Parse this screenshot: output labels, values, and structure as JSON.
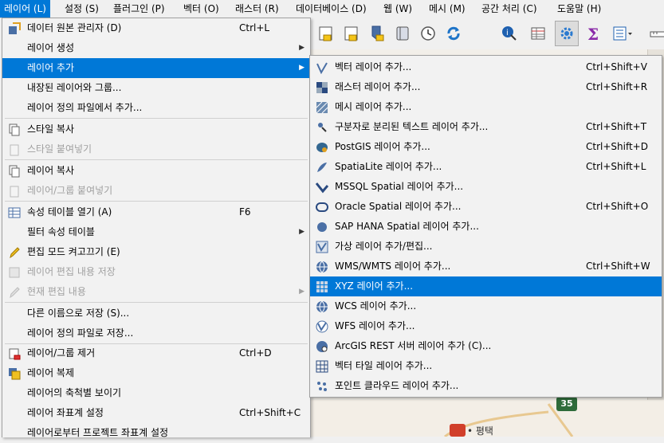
{
  "menubar": {
    "items": [
      {
        "label": "레이어 (L)",
        "active": true
      },
      {
        "label": "설정 (S)"
      },
      {
        "label": "플러그인 (P)"
      },
      {
        "label": "벡터 (O)"
      },
      {
        "label": "래스터 (R)"
      },
      {
        "label": "데이터베이스 (D)"
      },
      {
        "label": "웹 (W)"
      },
      {
        "label": "메시 (M)"
      },
      {
        "label": "공간 처리 (C)"
      },
      {
        "label": "도움말 (H)"
      }
    ]
  },
  "layer_menu": {
    "items": [
      {
        "label": "데이터 원본 관리자 (D)",
        "shortcut": "Ctrl+L",
        "icon": "data-source-manager-icon"
      },
      {
        "label": "레이어 생성",
        "submenu": true
      },
      {
        "label": "레이어 추가",
        "submenu": true,
        "highlighted": true
      },
      {
        "label": "내장된 레이어와 그룹..."
      },
      {
        "label": "레이어 정의 파일에서 추가..."
      },
      {
        "label": "스타일 복사",
        "icon": "copy-style-icon"
      },
      {
        "label": "스타일 붙여넣기",
        "icon": "paste-style-icon",
        "disabled": true
      },
      {
        "label": "레이어 복사",
        "icon": "copy-layer-icon"
      },
      {
        "label": "레이어/그룹 붙여넣기",
        "icon": "paste-layer-icon",
        "disabled": true
      },
      {
        "label": "속성 테이블 열기 (A)",
        "shortcut": "F6",
        "icon": "attribute-table-icon"
      },
      {
        "label": "필터 속성 테이블",
        "submenu": true
      },
      {
        "label": "편집 모드 켜고끄기 (E)",
        "icon": "toggle-editing-icon"
      },
      {
        "label": "레이어 편집 내용 저장",
        "icon": "save-edits-icon",
        "disabled": true
      },
      {
        "label": "현재 편집 내용",
        "icon": "current-edits-icon",
        "disabled": true,
        "submenu": true
      },
      {
        "label": "다른 이름으로 저장 (S)..."
      },
      {
        "label": "레이어 정의 파일로 저장..."
      },
      {
        "label": "레이어/그룹 제거",
        "shortcut": "Ctrl+D",
        "icon": "remove-layer-icon"
      },
      {
        "label": "레이어 복제",
        "icon": "duplicate-layer-icon"
      },
      {
        "label": "레이어의 축척별 보이기"
      },
      {
        "label": "레이어 좌표계 설정",
        "shortcut": "Ctrl+Shift+C"
      },
      {
        "label": "레이어로부터 프로젝트 좌표계 설정"
      }
    ]
  },
  "add_layer_menu": {
    "items": [
      {
        "label": "벡터 레이어 추가...",
        "shortcut": "Ctrl+Shift+V",
        "icon": "add-vector-layer-icon"
      },
      {
        "label": "래스터 레이어 추가...",
        "shortcut": "Ctrl+Shift+R",
        "icon": "add-raster-layer-icon"
      },
      {
        "label": "메시 레이어 추가...",
        "icon": "add-mesh-layer-icon"
      },
      {
        "label": "구분자로 분리된 텍스트 레이어 추가...",
        "shortcut": "Ctrl+Shift+T",
        "icon": "add-delimited-text-icon"
      },
      {
        "label": "PostGIS 레이어 추가...",
        "shortcut": "Ctrl+Shift+D",
        "icon": "add-postgis-icon"
      },
      {
        "label": "SpatiaLite 레이어 추가...",
        "shortcut": "Ctrl+Shift+L",
        "icon": "add-spatialite-icon"
      },
      {
        "label": "MSSQL Spatial 레이어 추가...",
        "icon": "add-mssql-icon"
      },
      {
        "label": "Oracle Spatial 레이어 추가...",
        "shortcut": "Ctrl+Shift+O",
        "icon": "add-oracle-icon"
      },
      {
        "label": "SAP HANA Spatial 레이어 추가...",
        "icon": "add-hana-icon"
      },
      {
        "label": "가상 레이어 추가/편집...",
        "icon": "add-virtual-layer-icon"
      },
      {
        "label": "WMS/WMTS 레이어 추가...",
        "shortcut": "Ctrl+Shift+W",
        "icon": "add-wms-icon"
      },
      {
        "label": "XYZ 레이어 추가...",
        "icon": "add-xyz-icon",
        "highlighted": true
      },
      {
        "label": "WCS 레이어 추가...",
        "icon": "add-wcs-icon"
      },
      {
        "label": "WFS 레이어 추가...",
        "icon": "add-wfs-icon"
      },
      {
        "label": "ArcGIS REST 서버 레이어 추가 (C)...",
        "icon": "add-arcgis-icon"
      },
      {
        "label": "벡터 타일 레이어 추가...",
        "icon": "add-vector-tile-icon"
      },
      {
        "label": "포인트 클라우드 레이어 추가...",
        "icon": "add-point-cloud-icon"
      }
    ]
  },
  "toolbar": {
    "buttons": [
      {
        "icon": "new-shapefile-icon"
      },
      {
        "icon": "new-geopackage-icon"
      },
      {
        "icon": "new-spatialite-icon"
      },
      {
        "icon": "new-memory-layer-icon"
      },
      {
        "icon": "temporal-controller-icon"
      },
      {
        "icon": "refresh-icon"
      },
      {
        "icon": "identify-icon"
      },
      {
        "icon": "attribute-table-icon"
      },
      {
        "icon": "processing-toolbox-icon",
        "pressed": true
      },
      {
        "icon": "statistics-icon"
      },
      {
        "icon": "layer-list-icon"
      },
      {
        "icon": "measure-icon"
      }
    ]
  },
  "map": {
    "road_badge": "35",
    "place_label": "• 평택"
  },
  "colors": {
    "highlight": "#0078d7",
    "menu_bg": "#f2f2f2",
    "disabled_text": "#a0a0a0"
  }
}
